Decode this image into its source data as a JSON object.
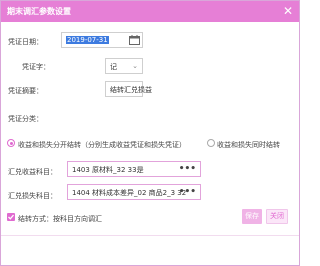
{
  "dialog": {
    "title": "期末调汇参数设置",
    "close_glyph": "✕"
  },
  "form": {
    "date_label": "凭证日期：",
    "date_value": "2019-07-31",
    "voucher_label": "凭证字：",
    "voucher_value": "记",
    "summary_label": "凭证摘要：",
    "summary_value": "结转汇兑损益",
    "category_label": "凭证分类：",
    "option1_label": "收益和损失分开结转（分别生成收益凭证和损失凭证）",
    "option2_label": "收益和损失同时结转",
    "gain_label": "汇兑收益科目：",
    "gain_value": "1403 原材料_32 33是",
    "loss_label": "汇兑损失科目：",
    "loss_value": "1404 材料成本差异_02 商品2_3 32",
    "lookup_glyph": "•••",
    "method_label": "结转方式：按科目方向调汇",
    "method_checked": true
  },
  "buttons": {
    "save": "保存",
    "close": "关闭"
  },
  "colors": {
    "accent": "#e67fd6",
    "date_highlight": "#3d7be0"
  }
}
